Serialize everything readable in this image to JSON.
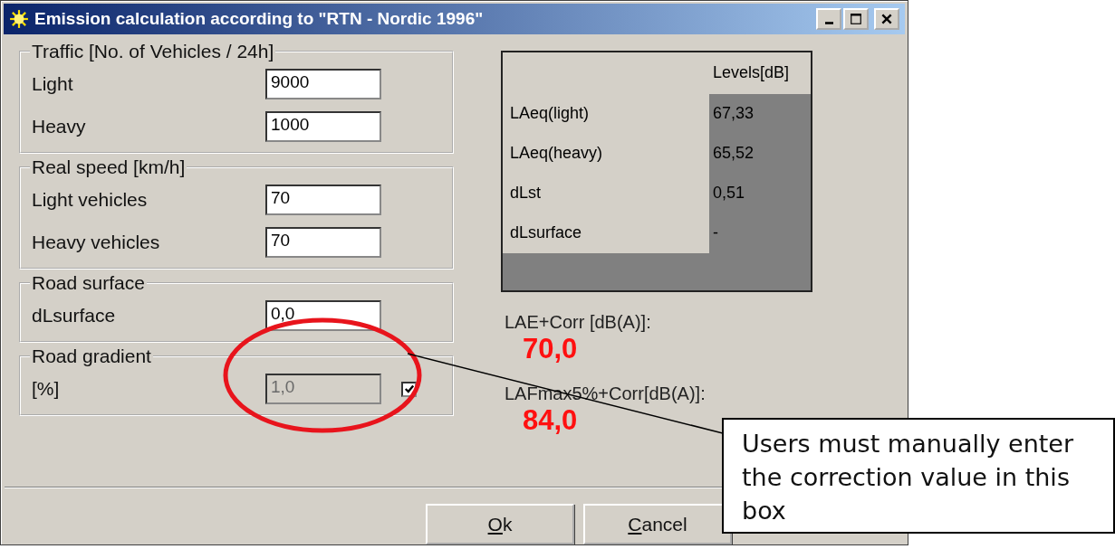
{
  "window": {
    "title": "Emission calculation according to \"RTN - Nordic 1996\""
  },
  "groups": [
    {
      "title": "Traffic [No. of Vehicles / 24h]",
      "fields": [
        {
          "label": "Light",
          "value": "9000",
          "disabled": false
        },
        {
          "label": "Heavy",
          "value": "1000",
          "disabled": false
        }
      ]
    },
    {
      "title": "Real speed [km/h]",
      "fields": [
        {
          "label": "Light vehicles",
          "value": "70",
          "disabled": false
        },
        {
          "label": "Heavy vehicles",
          "value": "70",
          "disabled": false
        }
      ]
    },
    {
      "title": "Road surface",
      "fields": [
        {
          "label": "dLsurface",
          "value": "0,0",
          "disabled": false
        }
      ]
    },
    {
      "title": "Road gradient",
      "fields": [
        {
          "label": "[%]",
          "value": "1,0",
          "disabled": true,
          "checkbox": {
            "checked": true
          }
        }
      ]
    }
  ],
  "levels_table": {
    "header": "Levels[dB]",
    "rows": [
      {
        "label": "LAeq(light)",
        "value": "67,33"
      },
      {
        "label": "LAeq(heavy)",
        "value": "65,52"
      },
      {
        "label": "dLst",
        "value": "0,51"
      },
      {
        "label": "dLsurface",
        "value": "-"
      }
    ]
  },
  "results": [
    {
      "label": "LAE+Corr [dB(A)]:",
      "value": "70,0"
    },
    {
      "label": "LAFmax5%+Corr[dB(A)]:",
      "value": "84,0"
    }
  ],
  "buttons": [
    {
      "label": "Ok",
      "mnemonic": true
    },
    {
      "label": "Cancel",
      "mnemonic": true
    }
  ],
  "annotation": {
    "callout": "Users must manually enter the correction value in this box"
  }
}
